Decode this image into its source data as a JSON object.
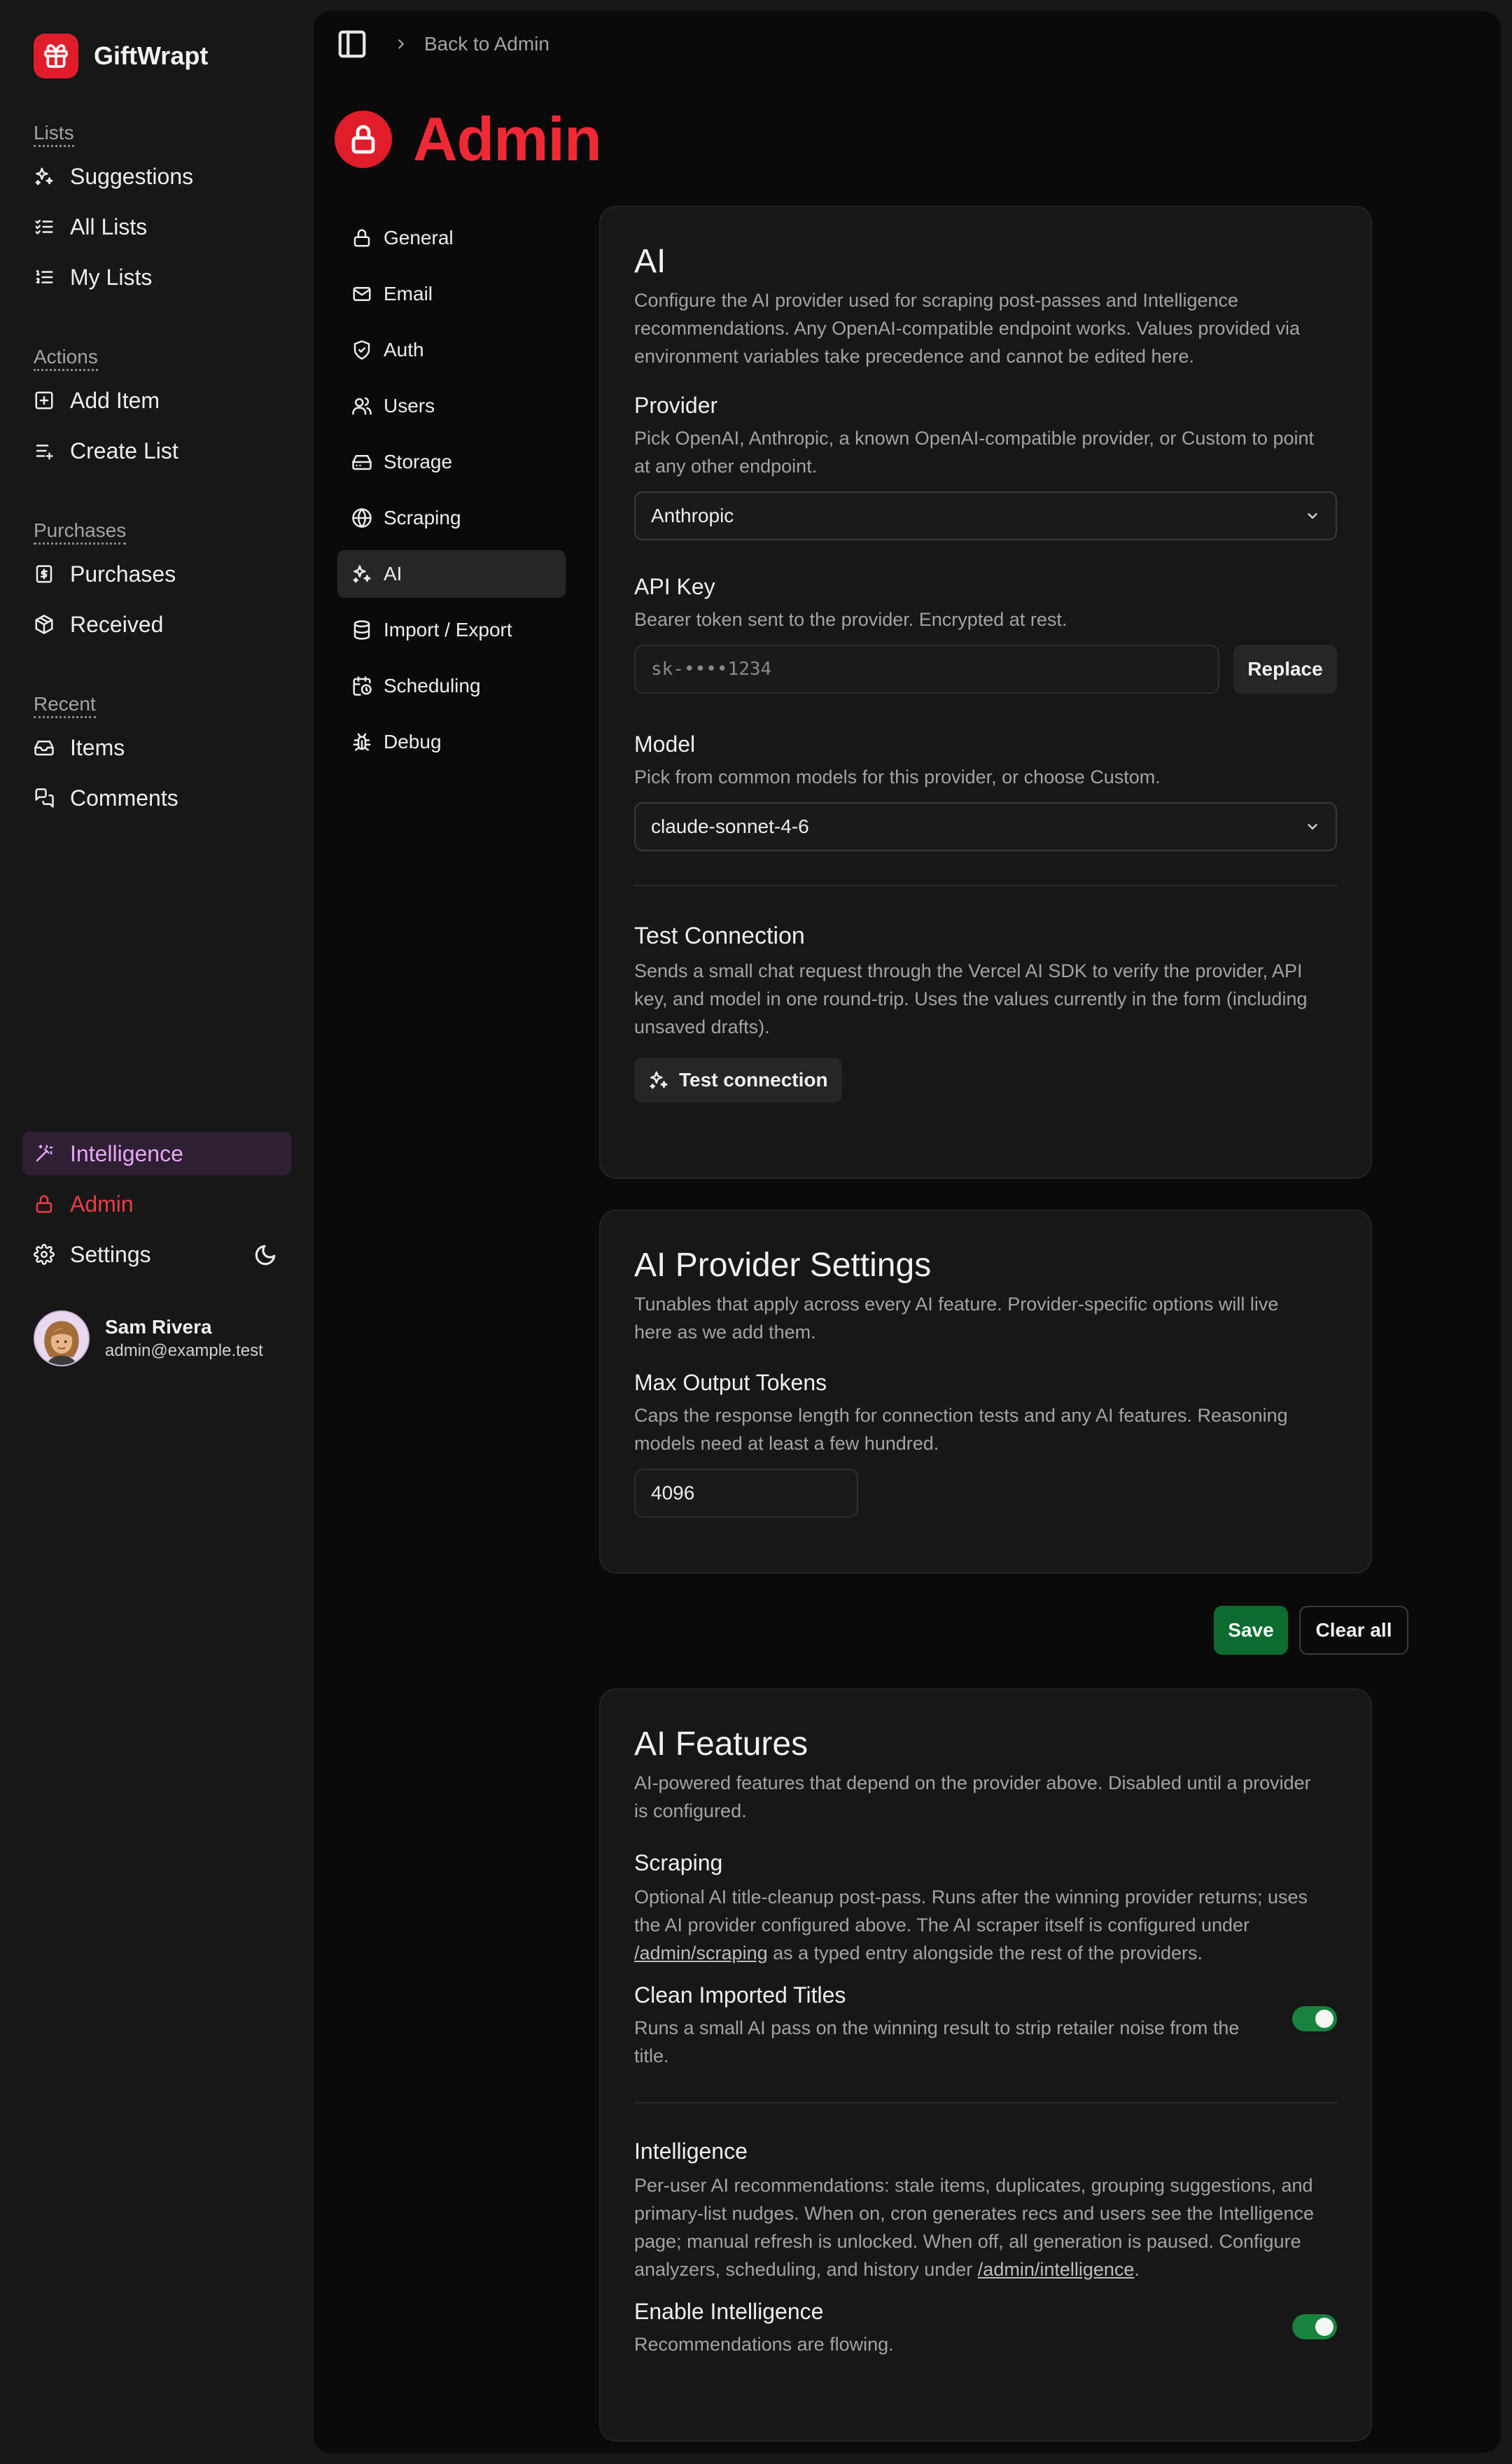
{
  "app": {
    "name": "GiftWrapt"
  },
  "sidebar": {
    "groups": [
      {
        "label": "Lists",
        "items": [
          {
            "label": "Suggestions",
            "icon": "sparkles-icon"
          },
          {
            "label": "All Lists",
            "icon": "list-check-icon"
          },
          {
            "label": "My Lists",
            "icon": "list-ordered-icon"
          }
        ]
      },
      {
        "label": "Actions",
        "items": [
          {
            "label": "Add Item",
            "icon": "square-plus-icon"
          },
          {
            "label": "Create List",
            "icon": "list-plus-icon"
          }
        ]
      },
      {
        "label": "Purchases",
        "items": [
          {
            "label": "Purchases",
            "icon": "receipt-icon"
          },
          {
            "label": "Received",
            "icon": "package-icon"
          }
        ]
      },
      {
        "label": "Recent",
        "items": [
          {
            "label": "Items",
            "icon": "inbox-icon"
          },
          {
            "label": "Comments",
            "icon": "messages-icon"
          }
        ]
      }
    ],
    "bottom": {
      "intelligence": "Intelligence",
      "admin": "Admin",
      "settings": "Settings"
    },
    "user": {
      "name": "Sam Rivera",
      "email": "admin@example.test"
    }
  },
  "topbar": {
    "breadcrumb": "Back to Admin"
  },
  "page": {
    "title": "Admin"
  },
  "subnav": [
    "General",
    "Email",
    "Auth",
    "Users",
    "Storage",
    "Scraping",
    "AI",
    "Import / Export",
    "Scheduling",
    "Debug"
  ],
  "subnav_active": "AI",
  "ai_card": {
    "title": "AI",
    "desc_1": "Configure the AI provider used for scraping post-passes and Intelligence",
    "desc_2": "recommendations. Any OpenAI-compatible endpoint works. Values provided via",
    "desc_3": "environment variables take precedence and cannot be edited here.",
    "provider_label": "Provider",
    "provider_desc_1": "Pick OpenAI, Anthropic, a known OpenAI-compatible provider, or Custom to point",
    "provider_desc_2": "at any other endpoint.",
    "provider_value": "Anthropic",
    "apikey_label": "API Key",
    "apikey_desc": "Bearer token sent to the provider. Encrypted at rest.",
    "apikey_value": "sk-••••1234",
    "replace_label": "Replace",
    "model_label": "Model",
    "model_desc": "Pick from common models for this provider, or choose Custom.",
    "model_value": "claude-sonnet-4-6",
    "test_label": "Test Connection",
    "test_desc_1": "Sends a small chat request through the Vercel AI SDK to verify the provider, API",
    "test_desc_2": "key, and model in one round-trip. Uses the values currently in the form (including",
    "test_desc_3": "unsaved drafts).",
    "test_button": "Test connection"
  },
  "provider_card": {
    "title": "AI Provider Settings",
    "desc_1": "Tunables that apply across every AI feature. Provider-specific options will live",
    "desc_2": "here as we add them.",
    "max_tokens_label": "Max Output Tokens",
    "max_tokens_desc_1": "Caps the response length for connection tests and any AI features. Reasoning",
    "max_tokens_desc_2": "models need at least a few hundred.",
    "max_tokens_value": "4096"
  },
  "actions": {
    "save": "Save",
    "clear": "Clear all"
  },
  "features_card": {
    "title": "AI Features",
    "desc_1": "AI-powered features that depend on the provider above. Disabled until a provider",
    "desc_2": "is configured.",
    "scraping_label": "Scraping",
    "scraping_desc_1": "Optional AI title-cleanup post-pass. Runs after the winning provider returns; uses",
    "scraping_desc_2": "the AI provider configured above. The AI scraper itself is configured under",
    "scraping_link": "/admin/scraping",
    "scraping_desc_3": " as a typed entry alongside the rest of the providers.",
    "clean_label": "Clean Imported Titles",
    "clean_desc_1": "Runs a small AI pass on the winning result to strip retailer noise from the",
    "clean_desc_2": "title.",
    "clean_enabled": true,
    "intel_label": "Intelligence",
    "intel_desc_1": "Per-user AI recommendations: stale items, duplicates, grouping suggestions, and",
    "intel_desc_2": "primary-list nudges. When on, cron generates recs and users see the Intelligence",
    "intel_desc_3": "page; manual refresh is unlocked. When off, all generation is paused. Configure",
    "intel_desc_4": "analyzers, scheduling, and history under ",
    "intel_link": "/admin/intelligence",
    "intel_desc_5": ".",
    "enable_label": "Enable Intelligence",
    "enable_desc": "Recommendations are flowing.",
    "intel_enabled": true
  },
  "colors": {
    "accent_red": "#e11d2b",
    "toggle_green": "#18823f",
    "save_green": "#0e6b30",
    "intelligence_purple": "#e7a6f5"
  }
}
